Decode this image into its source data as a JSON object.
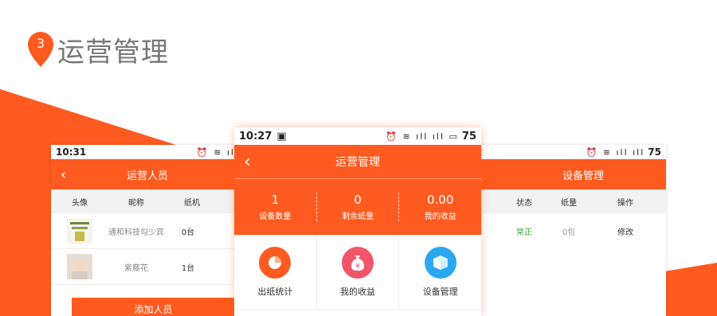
{
  "heading": {
    "number": "3",
    "title": "运营管理"
  },
  "colors": {
    "accent": "#ff5a1f",
    "status_ok": "#3aa335"
  },
  "left_phone": {
    "time": "10:31",
    "title": "运营人员",
    "columns": [
      "头像",
      "昵称",
      "纸机"
    ],
    "rows": [
      {
        "nick": "通和科技勾少宾",
        "count": "0台"
      },
      {
        "nick": "紫藤花",
        "count": "1台"
      }
    ],
    "add_button": "添加人员"
  },
  "center_phone": {
    "time": "10:27",
    "battery": "75",
    "title": "运营管理",
    "stats": [
      {
        "value": "1",
        "label": "设备数量"
      },
      {
        "value": "0",
        "label": "剩余纸量"
      },
      {
        "value": "0.00",
        "label": "我的收益"
      }
    ],
    "menu": [
      {
        "label": "出纸统计",
        "icon": "pie-chart-icon"
      },
      {
        "label": "我的收益",
        "icon": "money-bag-icon"
      },
      {
        "label": "设备管理",
        "icon": "box-icon"
      }
    ]
  },
  "right_phone": {
    "battery": "75",
    "title": "设备管理",
    "columns": [
      "状态",
      "纸量",
      "操作"
    ],
    "row": {
      "status": "常正",
      "paper": "0包",
      "action": "修改"
    }
  }
}
